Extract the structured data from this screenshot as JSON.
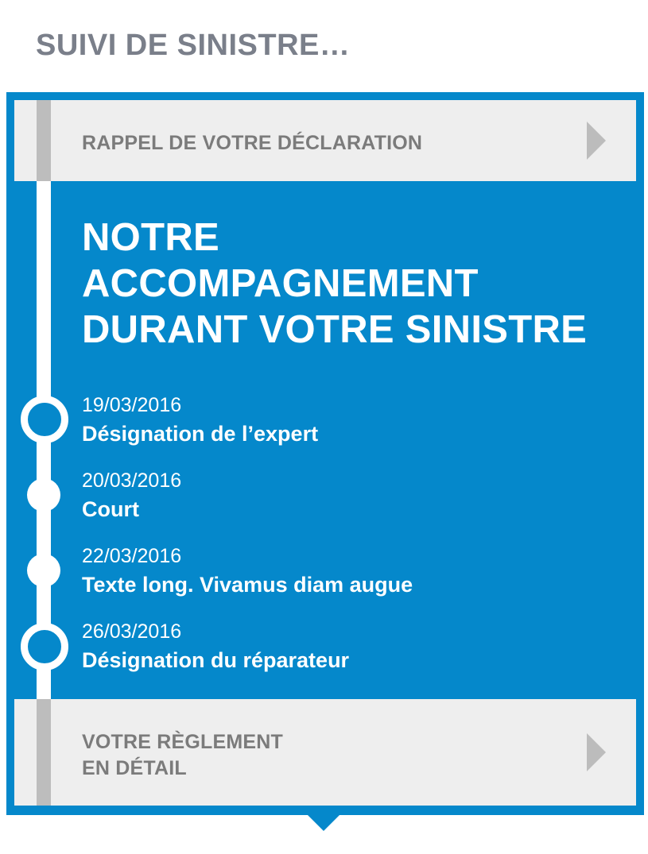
{
  "header": {
    "title": "SUIVI DE SINISTRE…"
  },
  "cards": {
    "top": {
      "label": "RAPPEL DE VOTRE DÉCLARATION"
    },
    "bottom": {
      "label_line1": "VOTRE RÈGLEMENT",
      "label_line2": "EN DÉTAIL"
    }
  },
  "main": {
    "title_line1": "NOTRE",
    "title_line2": "ACCOMPAGNEMENT",
    "title_line3": "DURANT VOTRE SINISTRE"
  },
  "timeline": [
    {
      "date": "19/03/2016",
      "label": "Désignation de l’expert",
      "marker": "ring"
    },
    {
      "date": "20/03/2016",
      "label": "Court",
      "marker": "dot"
    },
    {
      "date": "22/03/2016",
      "label": "Texte long. Vivamus diam augue",
      "marker": "dot"
    },
    {
      "date": "26/03/2016",
      "label": "Désignation du réparateur",
      "marker": "ring"
    }
  ],
  "colors": {
    "accent": "#0588cb",
    "card_background": "#eeeeee",
    "card_bar": "#bdbdbd",
    "card_text": "#7b7b7b",
    "title_text": "#7a7f8a"
  },
  "icons": {
    "card_arrow": "chevron-right-icon",
    "timeline_marker": "circle-icon"
  }
}
